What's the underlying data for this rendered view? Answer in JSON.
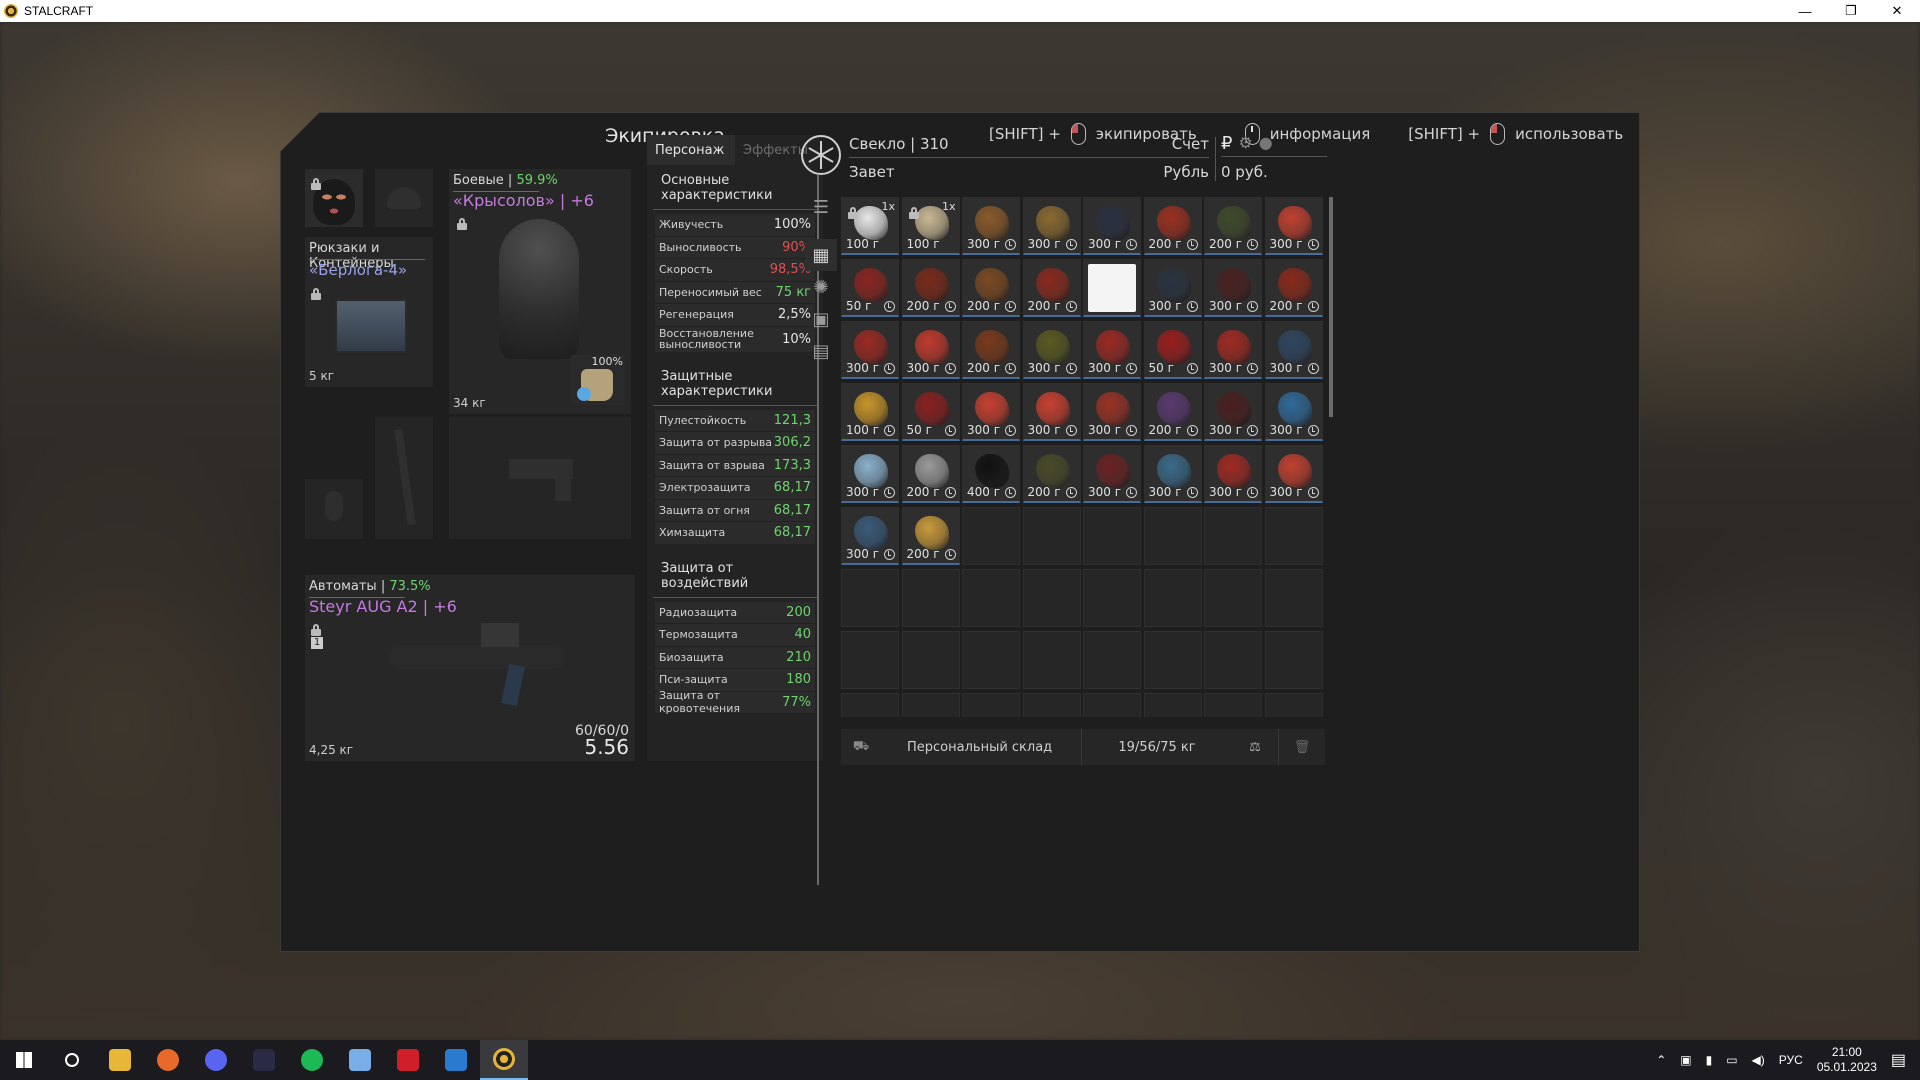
{
  "window": {
    "title": "STALCRAFT",
    "min": "—",
    "max": "❐",
    "close": "✕"
  },
  "header": {
    "title": "Экипировка",
    "hint_equip_mod": "[SHIFT] +",
    "hint_equip": "экипировать",
    "hint_info": "информация",
    "hint_use_mod": "[SHIFT] +",
    "hint_use": "использовать"
  },
  "equipment": {
    "backpack": {
      "category": "Рюкзаки и Контейнеры",
      "name": "«Берлога-4»",
      "weight": "5 кг"
    },
    "armor": {
      "category": "Боевые",
      "separator": " | ",
      "percent": "59.9%",
      "name": "«Крысолов» | +6",
      "weight": "34 кг",
      "durability": "100%"
    },
    "weapon": {
      "category": "Автоматы",
      "separator": " | ",
      "percent": "73.5%",
      "name": "Steyr AUG A2 | +6",
      "weight": "4,25 кг",
      "ammo": "60/60/0",
      "caliber": "5.56",
      "slot_number": "1"
    }
  },
  "stats": {
    "tab_character": "Персонаж",
    "tab_effects": "Эффекты",
    "main_title": "Основные характеристики",
    "main": [
      {
        "label": "Живучесть",
        "value": "100%",
        "color": "w"
      },
      {
        "label": "Выносливость",
        "value": "90%",
        "color": "r"
      },
      {
        "label": "Скорость",
        "value": "98,5%",
        "color": "r"
      },
      {
        "label": "Переносимый вес",
        "value": "75 кг",
        "color": "g"
      },
      {
        "label": "Регенерация",
        "value": "2,5%",
        "color": "w"
      },
      {
        "label": "Восстановление выносливости",
        "value": "10%",
        "color": "w"
      }
    ],
    "defense_title": "Защитные характеристики",
    "defense": [
      {
        "label": "Пулестойкость",
        "value": "121,3"
      },
      {
        "label": "Защита от разрыва",
        "value": "306,2"
      },
      {
        "label": "Защита от взрыва",
        "value": "173,3"
      },
      {
        "label": "Электрозащита",
        "value": "68,17"
      },
      {
        "label": "Защита от огня",
        "value": "68,17"
      },
      {
        "label": "Химзащита",
        "value": "68,17"
      }
    ],
    "effects_title": "Защита от воздействий",
    "effects": [
      {
        "label": "Радиозащита",
        "value": "200"
      },
      {
        "label": "Термозащита",
        "value": "40"
      },
      {
        "label": "Биозащита",
        "value": "210"
      },
      {
        "label": "Пси-защита",
        "value": "180"
      },
      {
        "label": "Защита от кровотечения",
        "value": "77%"
      }
    ]
  },
  "player": {
    "name": "Свекло | 310",
    "faction": "Завет",
    "account_label": "Счет",
    "currency_label": "Рубль",
    "balance": "0 руб.",
    "ruble_symbol": "₽"
  },
  "inventory": {
    "items": [
      {
        "w": "100 г",
        "c": "#e8e8e8",
        "lock": true,
        "count": "1x",
        "clock": false
      },
      {
        "w": "100 г",
        "c": "#c9b894",
        "lock": true,
        "count": "1x",
        "clock": false
      },
      {
        "w": "300 г",
        "c": "#8a5a2a"
      },
      {
        "w": "300 г",
        "c": "#8a6a30"
      },
      {
        "w": "300 г",
        "c": "#2a3040"
      },
      {
        "w": "200 г",
        "c": "#9a3020"
      },
      {
        "w": "200 г",
        "c": "#3e4a2c"
      },
      {
        "w": "300 г",
        "c": "#c04030"
      },
      {
        "w": "50 г",
        "c": "#8a2520"
      },
      {
        "w": "200 г",
        "c": "#7a2a1a"
      },
      {
        "w": "200 г",
        "c": "#7a4a22"
      },
      {
        "w": "200 г",
        "c": "#8a2a1e"
      },
      {
        "w": "",
        "c": "#ffffff",
        "clock": false
      },
      {
        "w": "300 г",
        "c": "#2a3340"
      },
      {
        "w": "300 г",
        "c": "#4a2020"
      },
      {
        "w": "200 г",
        "c": "#8a2a1c"
      },
      {
        "w": "300 г",
        "c": "#9a2a22"
      },
      {
        "w": "300 г",
        "c": "#c03a2e"
      },
      {
        "w": "200 г",
        "c": "#7a3a1c"
      },
      {
        "w": "300 г",
        "c": "#5a5a22"
      },
      {
        "w": "300 г",
        "c": "#9a2a22"
      },
      {
        "w": "50 г",
        "c": "#9a1e1e"
      },
      {
        "w": "300 г",
        "c": "#a02a22"
      },
      {
        "w": "300 г",
        "c": "#2e4660"
      },
      {
        "w": "100 г",
        "c": "#c8952a"
      },
      {
        "w": "50 г",
        "c": "#8a2020"
      },
      {
        "w": "300 г",
        "c": "#c84030"
      },
      {
        "w": "300 г",
        "c": "#c84030"
      },
      {
        "w": "300 г",
        "c": "#9a3224"
      },
      {
        "w": "200 г",
        "c": "#5a3a70"
      },
      {
        "w": "300 г",
        "c": "#4a1e1e"
      },
      {
        "w": "300 г",
        "c": "#2f6a9a"
      },
      {
        "w": "300 г",
        "c": "#8ab0cc"
      },
      {
        "w": "200 г",
        "c": "#9a9a9a"
      },
      {
        "w": "400 г",
        "c": "#101010"
      },
      {
        "w": "200 г",
        "c": "#4a4a2a"
      },
      {
        "w": "300 г",
        "c": "#6a2222"
      },
      {
        "w": "300 г",
        "c": "#3a6a8a"
      },
      {
        "w": "300 г",
        "c": "#a02a22"
      },
      {
        "w": "300 г",
        "c": "#c04030"
      },
      {
        "w": "300 г",
        "c": "#3a5a7a"
      },
      {
        "w": "200 г",
        "c": "#c89a3a"
      }
    ],
    "storage_label": "Персональный склад",
    "weight": "19/56/75 кг"
  },
  "taskbar": {
    "lang": "РУС",
    "time": "21:00",
    "date": "05.01.2023"
  },
  "colors": {
    "accent_green": "#6fd36f",
    "accent_red": "#e05050",
    "accent_purple": "#c47ae0"
  }
}
